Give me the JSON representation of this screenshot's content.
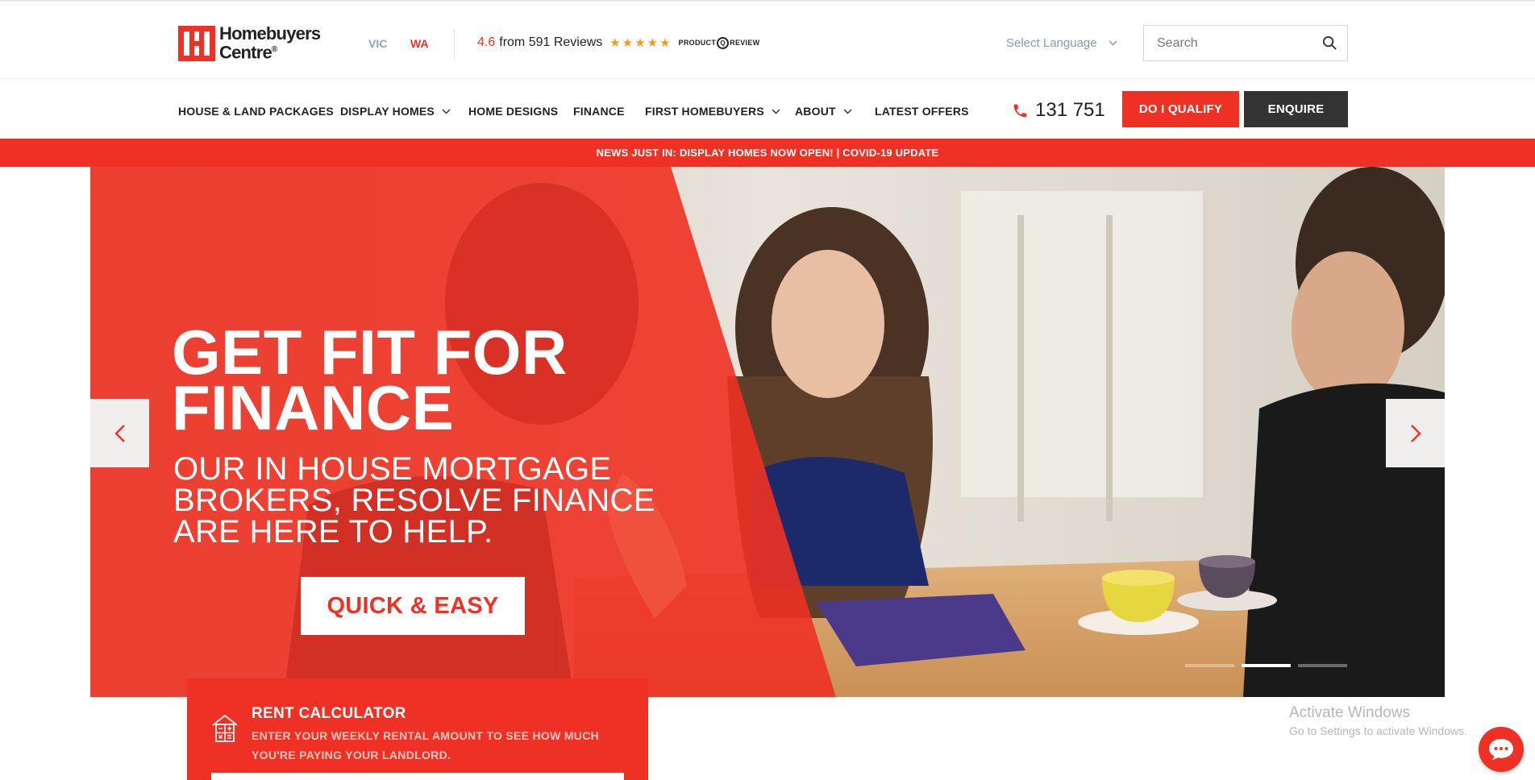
{
  "brand": {
    "line1": "Homebuyers",
    "line2": "Centre",
    "reg": "®",
    "color": "#ee3124"
  },
  "states": [
    "VIC",
    "WA"
  ],
  "rating": {
    "score": "4.6",
    "text": "from 591 Reviews",
    "stars": "★★★★★",
    "stars_value": 4.6,
    "provider_left": "PRODUCT",
    "provider_mid": "Q",
    "provider_right": "REVIEW"
  },
  "language": {
    "label": "Select Language"
  },
  "search": {
    "placeholder": "Search"
  },
  "nav": {
    "items": [
      {
        "label": "HOUSE & LAND PACKAGES",
        "has_dropdown": false
      },
      {
        "label": "DISPLAY HOMES",
        "has_dropdown": true
      },
      {
        "label": "HOME DESIGNS",
        "has_dropdown": false
      },
      {
        "label": "FINANCE",
        "has_dropdown": false
      },
      {
        "label": "FIRST HOMEBUYERS",
        "has_dropdown": true
      },
      {
        "label": "ABOUT",
        "has_dropdown": true
      },
      {
        "label": "LATEST OFFERS",
        "has_dropdown": false
      }
    ],
    "phone": "131 751",
    "qualify_label": "DO I QUALIFY",
    "enquire_label": "ENQUIRE"
  },
  "news": {
    "text": "NEWS JUST IN: DISPLAY HOMES NOW OPEN! | COVID-19 UPDATE"
  },
  "hero": {
    "title_line1": "GET FIT FOR",
    "title_line2": "FINANCE",
    "subtitle_line1": "OUR IN HOUSE MORTGAGE",
    "subtitle_line2": "BROKERS, RESOLVE FINANCE",
    "subtitle_line3": "ARE HERE TO HELP.",
    "cta_label": "QUICK & EASY",
    "slides_total": 3,
    "active_slide": 2
  },
  "rent_calculator": {
    "title": "RENT CALCULATOR",
    "description": "ENTER YOUR WEEKLY RENTAL AMOUNT TO SEE HOW MUCH YOU'RE PAYING YOUR LANDLORD."
  },
  "watermark": {
    "line1": "Activate Windows",
    "line2": "Go to Settings to activate Windows."
  },
  "colors": {
    "accent": "#ee3124",
    "dark": "#333333",
    "muted": "#8a99a8"
  },
  "icons": [
    "search-icon",
    "chevron-down-icon",
    "phone-icon",
    "chevron-left-icon",
    "chevron-right-icon",
    "calculator-house-icon",
    "chat-icon"
  ]
}
